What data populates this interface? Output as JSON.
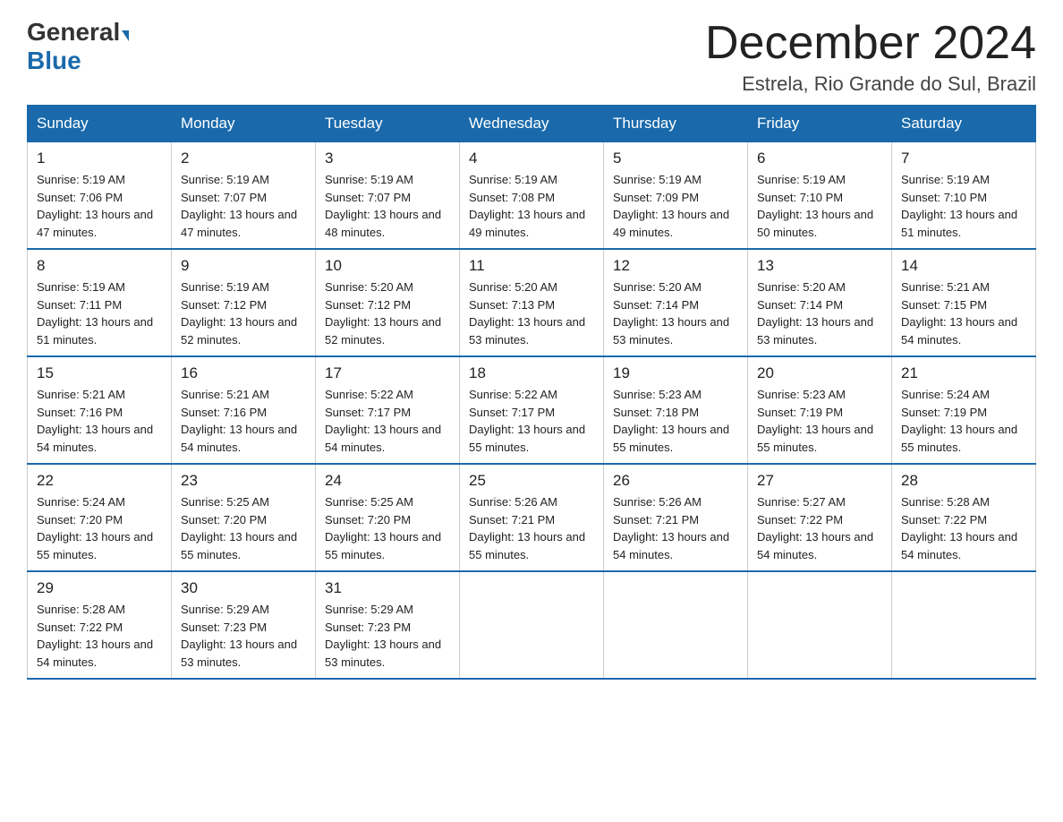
{
  "header": {
    "logo_general": "General",
    "logo_blue": "Blue",
    "month_title": "December 2024",
    "location": "Estrela, Rio Grande do Sul, Brazil"
  },
  "calendar": {
    "days_of_week": [
      "Sunday",
      "Monday",
      "Tuesday",
      "Wednesday",
      "Thursday",
      "Friday",
      "Saturday"
    ],
    "weeks": [
      [
        {
          "day": "1",
          "sunrise": "Sunrise: 5:19 AM",
          "sunset": "Sunset: 7:06 PM",
          "daylight": "Daylight: 13 hours and 47 minutes."
        },
        {
          "day": "2",
          "sunrise": "Sunrise: 5:19 AM",
          "sunset": "Sunset: 7:07 PM",
          "daylight": "Daylight: 13 hours and 47 minutes."
        },
        {
          "day": "3",
          "sunrise": "Sunrise: 5:19 AM",
          "sunset": "Sunset: 7:07 PM",
          "daylight": "Daylight: 13 hours and 48 minutes."
        },
        {
          "day": "4",
          "sunrise": "Sunrise: 5:19 AM",
          "sunset": "Sunset: 7:08 PM",
          "daylight": "Daylight: 13 hours and 49 minutes."
        },
        {
          "day": "5",
          "sunrise": "Sunrise: 5:19 AM",
          "sunset": "Sunset: 7:09 PM",
          "daylight": "Daylight: 13 hours and 49 minutes."
        },
        {
          "day": "6",
          "sunrise": "Sunrise: 5:19 AM",
          "sunset": "Sunset: 7:10 PM",
          "daylight": "Daylight: 13 hours and 50 minutes."
        },
        {
          "day": "7",
          "sunrise": "Sunrise: 5:19 AM",
          "sunset": "Sunset: 7:10 PM",
          "daylight": "Daylight: 13 hours and 51 minutes."
        }
      ],
      [
        {
          "day": "8",
          "sunrise": "Sunrise: 5:19 AM",
          "sunset": "Sunset: 7:11 PM",
          "daylight": "Daylight: 13 hours and 51 minutes."
        },
        {
          "day": "9",
          "sunrise": "Sunrise: 5:19 AM",
          "sunset": "Sunset: 7:12 PM",
          "daylight": "Daylight: 13 hours and 52 minutes."
        },
        {
          "day": "10",
          "sunrise": "Sunrise: 5:20 AM",
          "sunset": "Sunset: 7:12 PM",
          "daylight": "Daylight: 13 hours and 52 minutes."
        },
        {
          "day": "11",
          "sunrise": "Sunrise: 5:20 AM",
          "sunset": "Sunset: 7:13 PM",
          "daylight": "Daylight: 13 hours and 53 minutes."
        },
        {
          "day": "12",
          "sunrise": "Sunrise: 5:20 AM",
          "sunset": "Sunset: 7:14 PM",
          "daylight": "Daylight: 13 hours and 53 minutes."
        },
        {
          "day": "13",
          "sunrise": "Sunrise: 5:20 AM",
          "sunset": "Sunset: 7:14 PM",
          "daylight": "Daylight: 13 hours and 53 minutes."
        },
        {
          "day": "14",
          "sunrise": "Sunrise: 5:21 AM",
          "sunset": "Sunset: 7:15 PM",
          "daylight": "Daylight: 13 hours and 54 minutes."
        }
      ],
      [
        {
          "day": "15",
          "sunrise": "Sunrise: 5:21 AM",
          "sunset": "Sunset: 7:16 PM",
          "daylight": "Daylight: 13 hours and 54 minutes."
        },
        {
          "day": "16",
          "sunrise": "Sunrise: 5:21 AM",
          "sunset": "Sunset: 7:16 PM",
          "daylight": "Daylight: 13 hours and 54 minutes."
        },
        {
          "day": "17",
          "sunrise": "Sunrise: 5:22 AM",
          "sunset": "Sunset: 7:17 PM",
          "daylight": "Daylight: 13 hours and 54 minutes."
        },
        {
          "day": "18",
          "sunrise": "Sunrise: 5:22 AM",
          "sunset": "Sunset: 7:17 PM",
          "daylight": "Daylight: 13 hours and 55 minutes."
        },
        {
          "day": "19",
          "sunrise": "Sunrise: 5:23 AM",
          "sunset": "Sunset: 7:18 PM",
          "daylight": "Daylight: 13 hours and 55 minutes."
        },
        {
          "day": "20",
          "sunrise": "Sunrise: 5:23 AM",
          "sunset": "Sunset: 7:19 PM",
          "daylight": "Daylight: 13 hours and 55 minutes."
        },
        {
          "day": "21",
          "sunrise": "Sunrise: 5:24 AM",
          "sunset": "Sunset: 7:19 PM",
          "daylight": "Daylight: 13 hours and 55 minutes."
        }
      ],
      [
        {
          "day": "22",
          "sunrise": "Sunrise: 5:24 AM",
          "sunset": "Sunset: 7:20 PM",
          "daylight": "Daylight: 13 hours and 55 minutes."
        },
        {
          "day": "23",
          "sunrise": "Sunrise: 5:25 AM",
          "sunset": "Sunset: 7:20 PM",
          "daylight": "Daylight: 13 hours and 55 minutes."
        },
        {
          "day": "24",
          "sunrise": "Sunrise: 5:25 AM",
          "sunset": "Sunset: 7:20 PM",
          "daylight": "Daylight: 13 hours and 55 minutes."
        },
        {
          "day": "25",
          "sunrise": "Sunrise: 5:26 AM",
          "sunset": "Sunset: 7:21 PM",
          "daylight": "Daylight: 13 hours and 55 minutes."
        },
        {
          "day": "26",
          "sunrise": "Sunrise: 5:26 AM",
          "sunset": "Sunset: 7:21 PM",
          "daylight": "Daylight: 13 hours and 54 minutes."
        },
        {
          "day": "27",
          "sunrise": "Sunrise: 5:27 AM",
          "sunset": "Sunset: 7:22 PM",
          "daylight": "Daylight: 13 hours and 54 minutes."
        },
        {
          "day": "28",
          "sunrise": "Sunrise: 5:28 AM",
          "sunset": "Sunset: 7:22 PM",
          "daylight": "Daylight: 13 hours and 54 minutes."
        }
      ],
      [
        {
          "day": "29",
          "sunrise": "Sunrise: 5:28 AM",
          "sunset": "Sunset: 7:22 PM",
          "daylight": "Daylight: 13 hours and 54 minutes."
        },
        {
          "day": "30",
          "sunrise": "Sunrise: 5:29 AM",
          "sunset": "Sunset: 7:23 PM",
          "daylight": "Daylight: 13 hours and 53 minutes."
        },
        {
          "day": "31",
          "sunrise": "Sunrise: 5:29 AM",
          "sunset": "Sunset: 7:23 PM",
          "daylight": "Daylight: 13 hours and 53 minutes."
        },
        null,
        null,
        null,
        null
      ]
    ]
  }
}
